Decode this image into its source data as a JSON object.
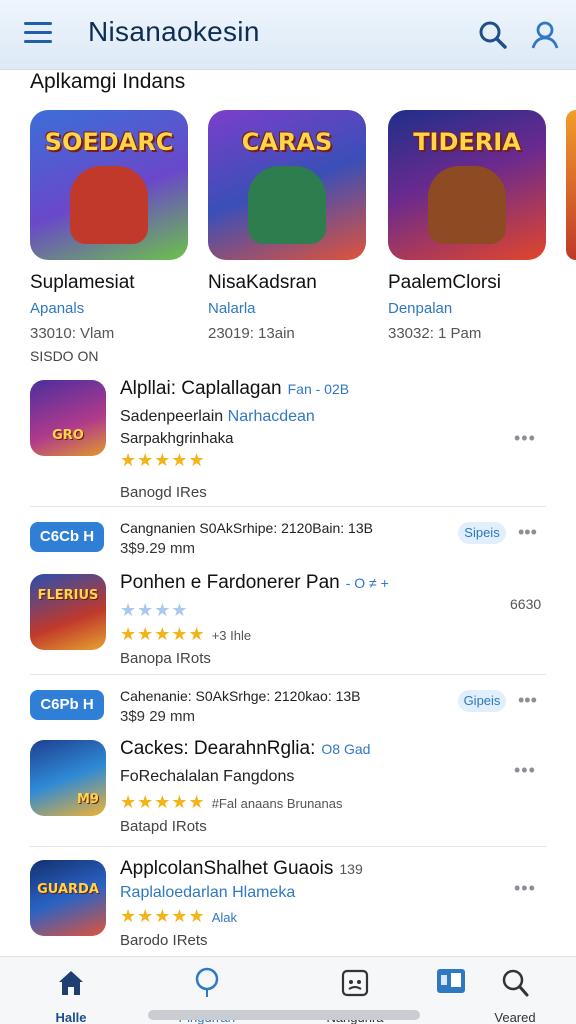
{
  "header": {
    "title": "Nisanaokesin"
  },
  "section_title": "Aplkamgi Indans",
  "featured": [
    {
      "logo": "SOEDARC",
      "name": "Suplamesiat",
      "developer": "Apanals",
      "meta": "33010: Vlam",
      "extra": "SISDO ON",
      "colors": [
        "#3b6fd8",
        "#6cc24a"
      ]
    },
    {
      "logo": "CARAS",
      "name": "NisaKadsran",
      "developer": "Nalarla",
      "meta": "23019: 13ain",
      "extra": "",
      "colors": [
        "#7b3fc9",
        "#e0533a"
      ]
    },
    {
      "logo": "TIDERIA",
      "name": "PaalemClorsi",
      "developer": "Denpalan",
      "meta": "33032: 1 Pam",
      "extra": "",
      "colors": [
        "#1f2f8a",
        "#e2462a"
      ]
    }
  ],
  "list": {
    "app1": {
      "logo": "GRO",
      "title": "Alpllai: Caplallagan",
      "title_suffix": "Fan - 02B",
      "sub_plain": "Sadenpeerlain",
      "sub_accent": "Narhacdean",
      "sub2": "Sarpakhgrinhaka",
      "stars": "★★★★★",
      "footer": "Banogd IRes"
    },
    "promo1": {
      "button": "C6Cb H",
      "line1": "Cangnanien S0AkSrhipe: 2120Bain: 13B",
      "line2": "3$9.29 mm",
      "badge": "Sipeis"
    },
    "app2": {
      "logo": "FLERIUS",
      "title": "Ponhen e Fardonerer Pan",
      "title_suffix": "- O ≠ +",
      "stars_faded": "★★★★",
      "stars": "★★★★★",
      "stars_note": "+3 Ihle",
      "side_value": "6630",
      "footer": "Banopa IRots"
    },
    "promo2": {
      "button": "C6Pb H",
      "line1": "Cahenanie: S0AkSrhge: 2120kao: 13B",
      "line2": "3$9 29 mm",
      "badge": "Gipeis"
    },
    "app3": {
      "logo": "M9",
      "title": "Cackes: DearahnRglia:",
      "title_suffix": "O8 Gad",
      "sub_plain": "FoRechalalan Fangdons",
      "stars": "★★★★★",
      "stars_note": "#Fal anaans Brunanas",
      "footer": "Batapd IRots"
    },
    "app4": {
      "logo": "GUARDA",
      "title": "ApplcolanShalhet Guaois",
      "title_suffix": "139",
      "sub_accent": "Raplaloedarlan Hlameka",
      "stars": "★★★★★",
      "stars_note": "Alak",
      "footer": "Barodo IRets"
    }
  },
  "nav": [
    {
      "label": "Halle",
      "icon": "home-icon"
    },
    {
      "label": "Pingurrarı",
      "icon": "balloon-icon"
    },
    {
      "label": "Nangunra",
      "icon": "robot-icon"
    },
    {
      "label": "",
      "icon": "app-icon"
    },
    {
      "label": "Veared",
      "icon": "search-icon"
    }
  ],
  "colors": {
    "accent": "#2f78c4",
    "header_bg": "#e3eef9",
    "star": "#f2b418"
  }
}
